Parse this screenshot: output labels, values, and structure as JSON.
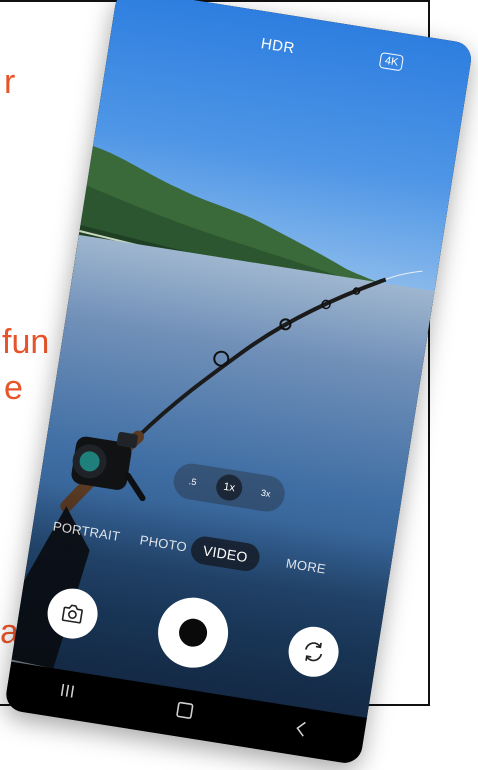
{
  "background_slide": {
    "fragments": [
      "r",
      "fun",
      "e",
      "a”"
    ],
    "accent_color": "#e8542a"
  },
  "camera": {
    "top_bar": {
      "hdr_label": "HDR",
      "resolution_badge": "4K"
    },
    "zoom": {
      "options": [
        ".5",
        "1x",
        "3x"
      ],
      "selected": "1x"
    },
    "modes": {
      "items": [
        "PORTRAIT",
        "PHOTO",
        "VIDEO",
        "MORE"
      ],
      "selected": "VIDEO"
    },
    "controls": {
      "gallery_icon": "camera-icon",
      "shutter_icon": "record-icon",
      "flip_icon": "flip-camera-icon"
    },
    "nav_bar": {
      "recents_icon": "recents-icon",
      "home_icon": "home-icon",
      "back_icon": "back-icon"
    }
  }
}
